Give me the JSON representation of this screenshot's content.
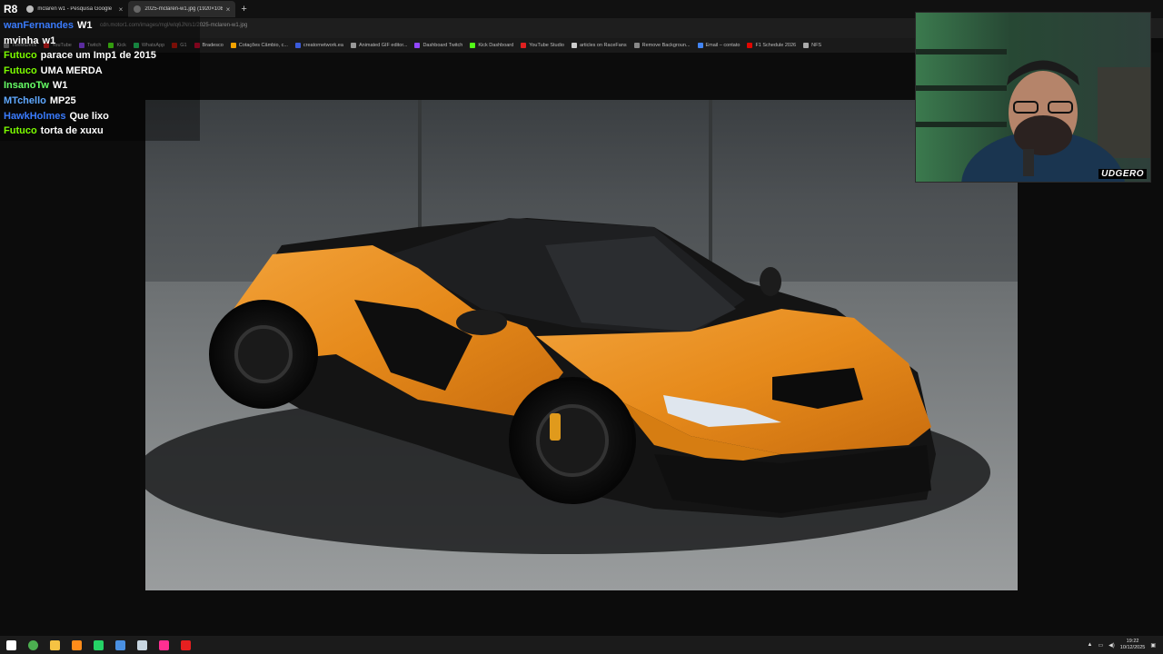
{
  "browser": {
    "brand": "R8",
    "tabs": [
      {
        "title": "mclaren w1 - Pesquisa Google",
        "active": false
      },
      {
        "title": "2025-mclaren-w1.jpg (1920×1080)",
        "active": true
      }
    ],
    "new_tab": "+",
    "close": "×",
    "address": "cdn.motor1.com/images/mgl/wlq6JN/s1/2025-mclaren-w1.jpg",
    "bookmarks": [
      {
        "label": "TweetDeck",
        "color": "#888888"
      },
      {
        "label": "YouTube",
        "color": "#e02020"
      },
      {
        "label": "Twitch",
        "color": "#9146ff"
      },
      {
        "label": "Kick",
        "color": "#53fc18"
      },
      {
        "label": "WhatsApp",
        "color": "#25d366"
      },
      {
        "label": "G1",
        "color": "#c4170c"
      },
      {
        "label": "Bradesco",
        "color": "#cc092f"
      },
      {
        "label": "Cotações Câmbio, c...",
        "color": "#f4a300"
      },
      {
        "label": "creatornetwork.ea",
        "color": "#3b5bdb"
      },
      {
        "label": "Animated GIF editor...",
        "color": "#999999"
      },
      {
        "label": "Dashboard Twitch",
        "color": "#9146ff"
      },
      {
        "label": "Kick Dashboard",
        "color": "#53fc18"
      },
      {
        "label": "YouTube Studio",
        "color": "#e02020"
      },
      {
        "label": "articles on RaceFans",
        "color": "#cccccc"
      },
      {
        "label": "Remove Backgroun...",
        "color": "#888888"
      },
      {
        "label": "Email – contato",
        "color": "#4285f4"
      },
      {
        "label": "F1 Schedule 2026",
        "color": "#e10600"
      },
      {
        "label": "NFS",
        "color": "#aaaaaa"
      }
    ]
  },
  "chat": {
    "messages": [
      {
        "user": "wanFernandes",
        "text": "W1",
        "color": "#3a7bfd"
      },
      {
        "user": "mvinha",
        "text": "w1",
        "color": "#ffffff"
      },
      {
        "user": "Futuco",
        "text": "parace um Imp1 de 2015",
        "color": "#7CFC00"
      },
      {
        "user": "Futuco",
        "text": "UMA MERDA",
        "color": "#7CFC00"
      },
      {
        "user": "InsanoTw",
        "text": "W1",
        "color": "#66ff66"
      },
      {
        "user": "MTchello",
        "text": "MP25",
        "color": "#5fa8ff"
      },
      {
        "user": "HawkHolmes",
        "text": "Que lixo",
        "color": "#3a7bfd"
      },
      {
        "user": "Futuco",
        "text": "torta de xuxu",
        "color": "#7CFC00"
      }
    ]
  },
  "webcam": {
    "logo": "UDGERO"
  },
  "image": {
    "subject": "McLaren W1 supercar, orange with black carbon, studio shot"
  },
  "taskbar": {
    "icons": [
      {
        "name": "windows-start-icon",
        "color": "#ffffff"
      },
      {
        "name": "chrome-icon",
        "color": "#4caf50"
      },
      {
        "name": "file-explorer-icon",
        "color": "#f6c343"
      },
      {
        "name": "app-orange-icon",
        "color": "#ff8c1a"
      },
      {
        "name": "whatsapp-icon",
        "color": "#25d366"
      },
      {
        "name": "app-blue-icon",
        "color": "#4a90e2"
      },
      {
        "name": "steam-icon",
        "color": "#c7d5e0"
      },
      {
        "name": "app-pink-icon",
        "color": "#ff2f92"
      },
      {
        "name": "app-red-icon",
        "color": "#e62020"
      }
    ],
    "clock_time": "19:22",
    "clock_date": "10/12/2025"
  }
}
